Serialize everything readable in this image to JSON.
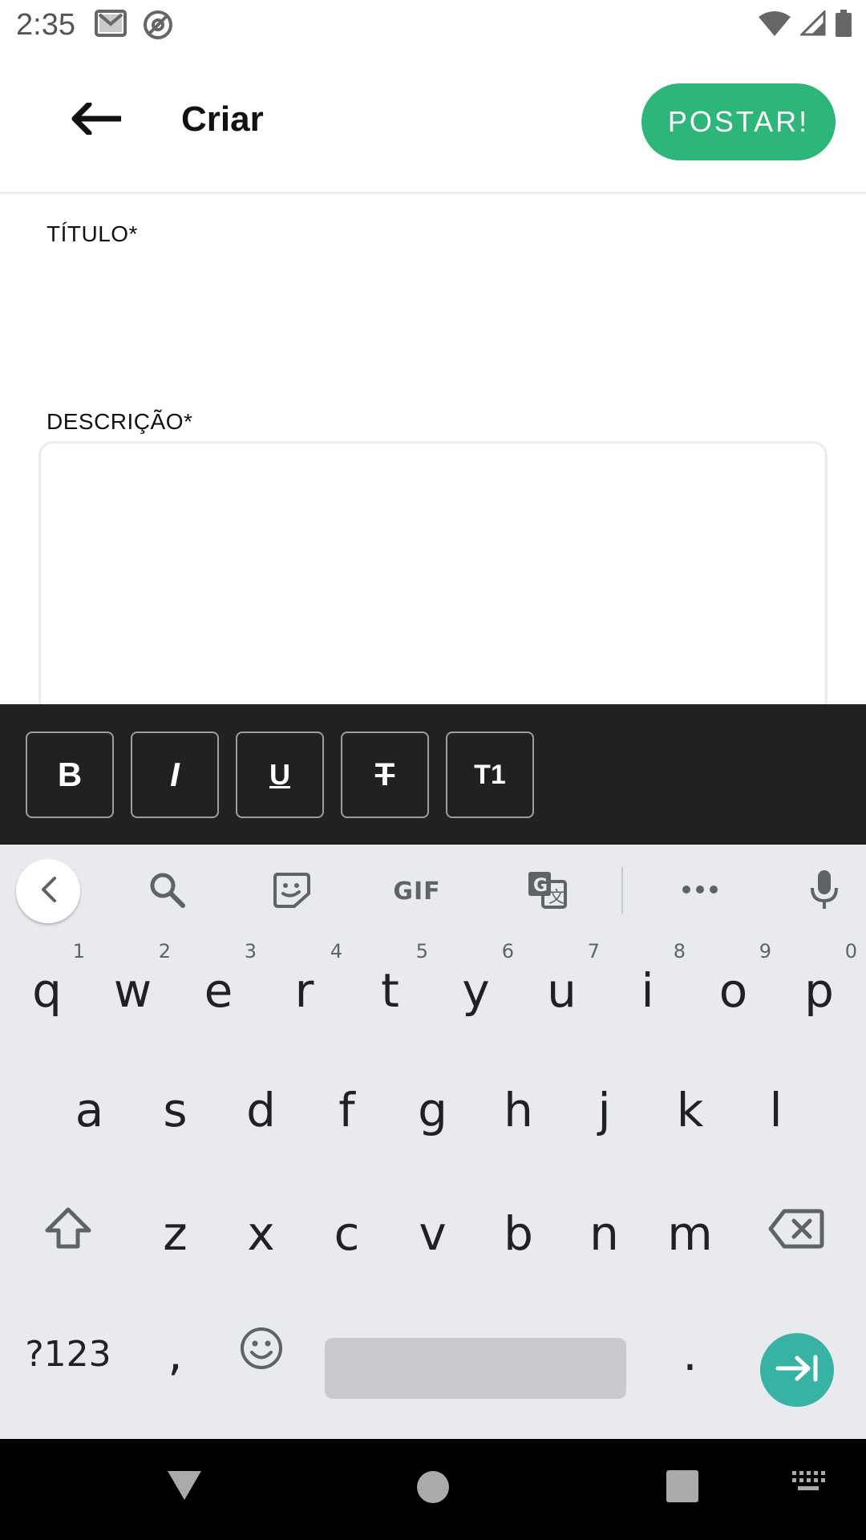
{
  "status_bar": {
    "time": "2:35",
    "icons_left": [
      "gmail-icon",
      "at-sign-icon"
    ],
    "icons_right": [
      "wifi-icon",
      "signal-icon",
      "battery-icon"
    ]
  },
  "app_bar": {
    "back_icon": "arrow-left-icon",
    "title": "Criar",
    "post_label": "POSTAR!",
    "post_color": "#2eb57a"
  },
  "form": {
    "title_label": "TÍTULO*",
    "title_value": "",
    "description_label": "DESCRIÇÃO*",
    "description_value": ""
  },
  "format_toolbar": {
    "background": "#212121",
    "buttons": [
      {
        "label": "B",
        "icon": "bold-icon"
      },
      {
        "label": "I",
        "icon": "italic-icon"
      },
      {
        "label": "U",
        "icon": "underline-icon"
      },
      {
        "label": "T",
        "icon": "strikethrough-icon"
      },
      {
        "label": "T1",
        "icon": "subscript-icon"
      }
    ]
  },
  "keyboard": {
    "toolbar": {
      "back_icon": "chevron-left-icon",
      "search_icon": "search-icon",
      "sticker_icon": "sticker-icon",
      "gif_label": "GIF",
      "translate_icon": "translate-icon",
      "more_icon": "more-horizontal-icon",
      "mic_icon": "microphone-icon"
    },
    "row1": [
      "q",
      "w",
      "e",
      "r",
      "t",
      "y",
      "u",
      "i",
      "o",
      "p"
    ],
    "row1_hints": [
      "1",
      "2",
      "3",
      "4",
      "5",
      "6",
      "7",
      "8",
      "9",
      "0"
    ],
    "row2": [
      "a",
      "s",
      "d",
      "f",
      "g",
      "h",
      "j",
      "k",
      "l"
    ],
    "row3": [
      "z",
      "x",
      "c",
      "v",
      "b",
      "n",
      "m"
    ],
    "shift_icon": "shift-icon",
    "backspace_icon": "backspace-icon",
    "symbols_label": "?123",
    "comma": ",",
    "emoji_icon": "emoji-icon",
    "period": ".",
    "enter_icon": "tab-next-icon",
    "enter_color": "#38b3a3"
  },
  "nav_bar": {
    "back_icon": "nav-back-triangle-icon",
    "home_icon": "nav-home-circle-icon",
    "recents_icon": "nav-recents-square-icon",
    "keyboard_icon": "keyboard-hide-icon"
  }
}
